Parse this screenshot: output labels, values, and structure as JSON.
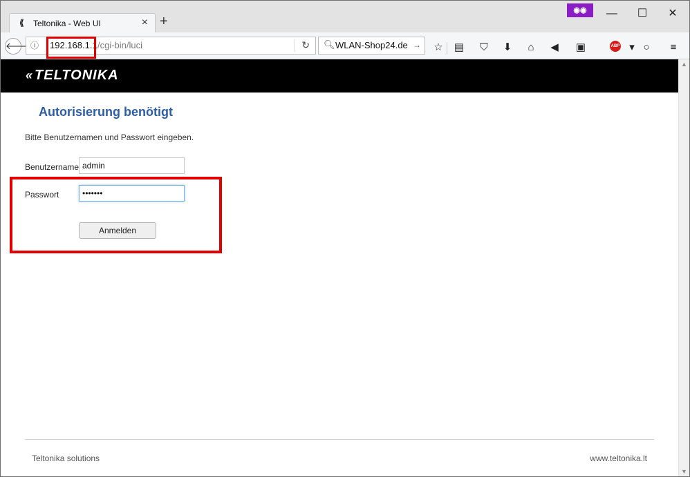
{
  "browser": {
    "tab_title": "Teltonika - Web UI",
    "tab_close": "×",
    "new_tab": "+",
    "private_badge": "👓",
    "window_controls": {
      "minimize": "—",
      "maximize": "☐",
      "close": "✕"
    },
    "url": {
      "host": "192.168.1.1",
      "path": "/cgi-bin/luci"
    },
    "search": {
      "text": "WLAN-Shop24.de"
    },
    "toolbar_icons": [
      "star-icon",
      "reader-icon",
      "pocket-icon",
      "download-icon",
      "home-icon",
      "send-icon",
      "sync-icon",
      "adblock-icon",
      "chat-icon",
      "menu-icon"
    ],
    "adblock_label": "ABP"
  },
  "page": {
    "brand": "TELTONIKA",
    "title": "Autorisierung benötigt",
    "description": "Bitte Benutzernamen und Passwort eingeben.",
    "username_label": "Benutzername",
    "username_value": "admin",
    "password_label": "Passwort",
    "password_value": "•••••••",
    "login_button": "Anmelden",
    "footer_left": "Teltonika solutions",
    "footer_right": "www.teltonika.lt"
  },
  "colors": {
    "title": "#2c5ea5",
    "highlight": "#e00000",
    "brand_bar": "#000000",
    "private": "#8a1ec4"
  }
}
